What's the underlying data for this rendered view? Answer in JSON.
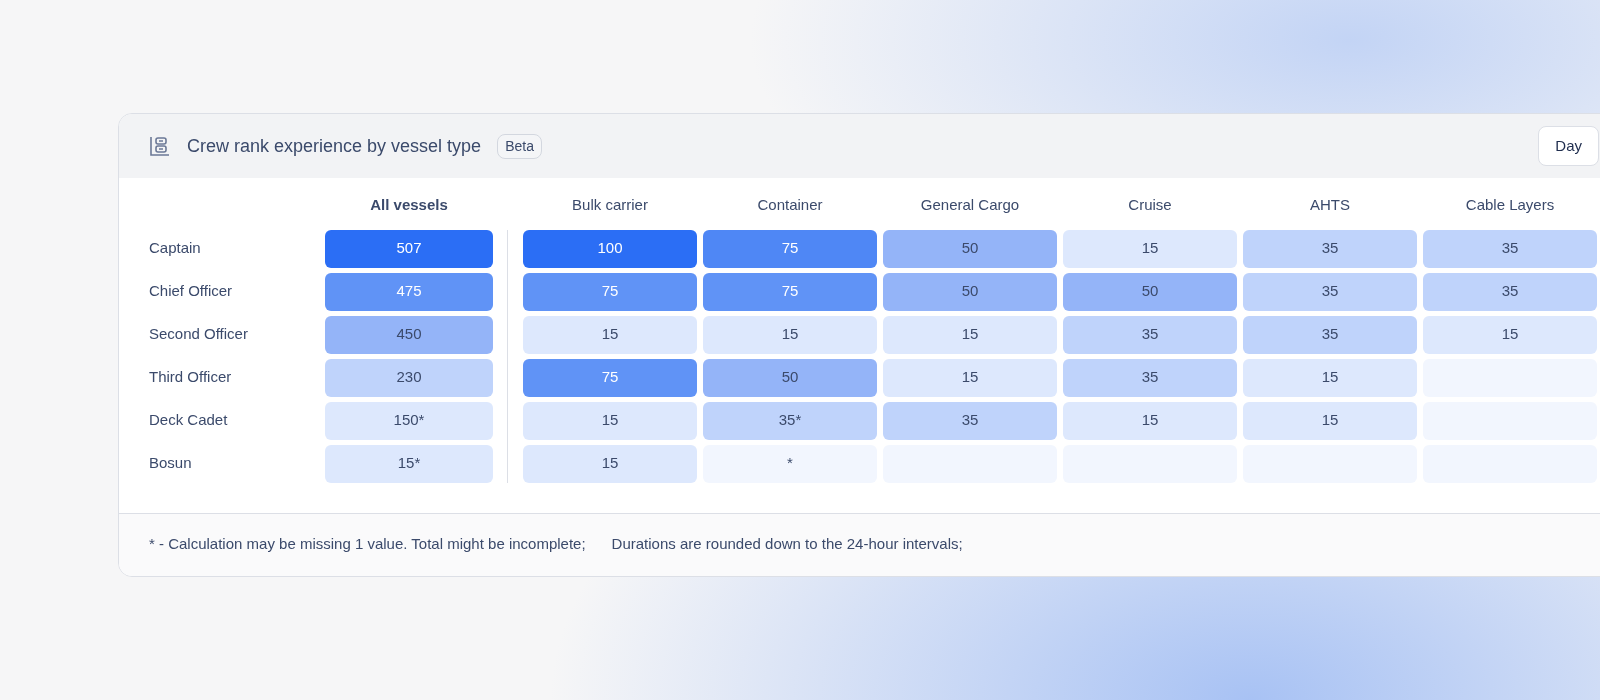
{
  "header": {
    "title": "Crew rank experience by vessel type",
    "badge": "Beta",
    "button": "Day"
  },
  "columns": [
    {
      "label": "All vessels",
      "kind": "total"
    },
    {
      "label": "Bulk carrier",
      "kind": "type"
    },
    {
      "label": "Container",
      "kind": "type"
    },
    {
      "label": "General Cargo",
      "kind": "type"
    },
    {
      "label": "Cruise",
      "kind": "type"
    },
    {
      "label": "AHTS",
      "kind": "type"
    },
    {
      "label": "Cable Layers",
      "kind": "type"
    }
  ],
  "rows": [
    {
      "label": "Captain",
      "cells": [
        {
          "text": "507",
          "color": "#2b6ef5"
        },
        {
          "text": "100",
          "color": "#2b6ef5"
        },
        {
          "text": "75",
          "color": "#4f87f5"
        },
        {
          "text": "50",
          "color": "#94b4f8"
        },
        {
          "text": "15",
          "color": "#dde8fd"
        },
        {
          "text": "35",
          "color": "#bfd3fb"
        },
        {
          "text": "35",
          "color": "#bfd3fb"
        }
      ]
    },
    {
      "label": "Chief Officer",
      "cells": [
        {
          "text": "475",
          "color": "#6093f6"
        },
        {
          "text": "75",
          "color": "#6093f6"
        },
        {
          "text": "75",
          "color": "#6093f6"
        },
        {
          "text": "50",
          "color": "#94b4f8"
        },
        {
          "text": "50",
          "color": "#94b4f8"
        },
        {
          "text": "35",
          "color": "#bfd3fb"
        },
        {
          "text": "35",
          "color": "#bfd3fb"
        }
      ]
    },
    {
      "label": "Second Officer",
      "cells": [
        {
          "text": "450",
          "color": "#94b4f8"
        },
        {
          "text": "15",
          "color": "#dde8fd"
        },
        {
          "text": "15",
          "color": "#dde8fd"
        },
        {
          "text": "15",
          "color": "#dde8fd"
        },
        {
          "text": "35",
          "color": "#bfd3fb"
        },
        {
          "text": "35",
          "color": "#bfd3fb"
        },
        {
          "text": "15",
          "color": "#dde8fd"
        }
      ]
    },
    {
      "label": "Third Officer",
      "cells": [
        {
          "text": "230",
          "color": "#bfd3fb"
        },
        {
          "text": "75",
          "color": "#6093f6"
        },
        {
          "text": "50",
          "color": "#94b4f8"
        },
        {
          "text": "15",
          "color": "#dde8fd"
        },
        {
          "text": "35",
          "color": "#bfd3fb"
        },
        {
          "text": "15",
          "color": "#dde8fd"
        },
        {
          "color": "#f2f6fe"
        }
      ]
    },
    {
      "label": "Deck Cadet",
      "cells": [
        {
          "text": "150*",
          "color": "#dde8fd"
        },
        {
          "text": "15",
          "color": "#dde8fd"
        },
        {
          "text": "35*",
          "color": "#bfd3fb"
        },
        {
          "text": "35",
          "color": "#bfd3fb"
        },
        {
          "text": "15",
          "color": "#dde8fd"
        },
        {
          "text": "15",
          "color": "#dde8fd"
        },
        {
          "color": "#f2f6fe"
        }
      ]
    },
    {
      "label": "Bosun",
      "cells": [
        {
          "text": "15*",
          "color": "#dde8fd"
        },
        {
          "text": "15",
          "color": "#dde8fd"
        },
        {
          "text": "*",
          "color": "#f2f6fe"
        },
        {
          "color": "#f2f6fe"
        },
        {
          "color": "#f2f6fe"
        },
        {
          "color": "#f2f6fe"
        },
        {
          "color": "#f2f6fe"
        }
      ]
    }
  ],
  "footnotes": [
    "* - Calculation may be missing 1 value. Total might be incomplete;",
    "Durations are rounded down to the 24-hour intervals;"
  ]
}
